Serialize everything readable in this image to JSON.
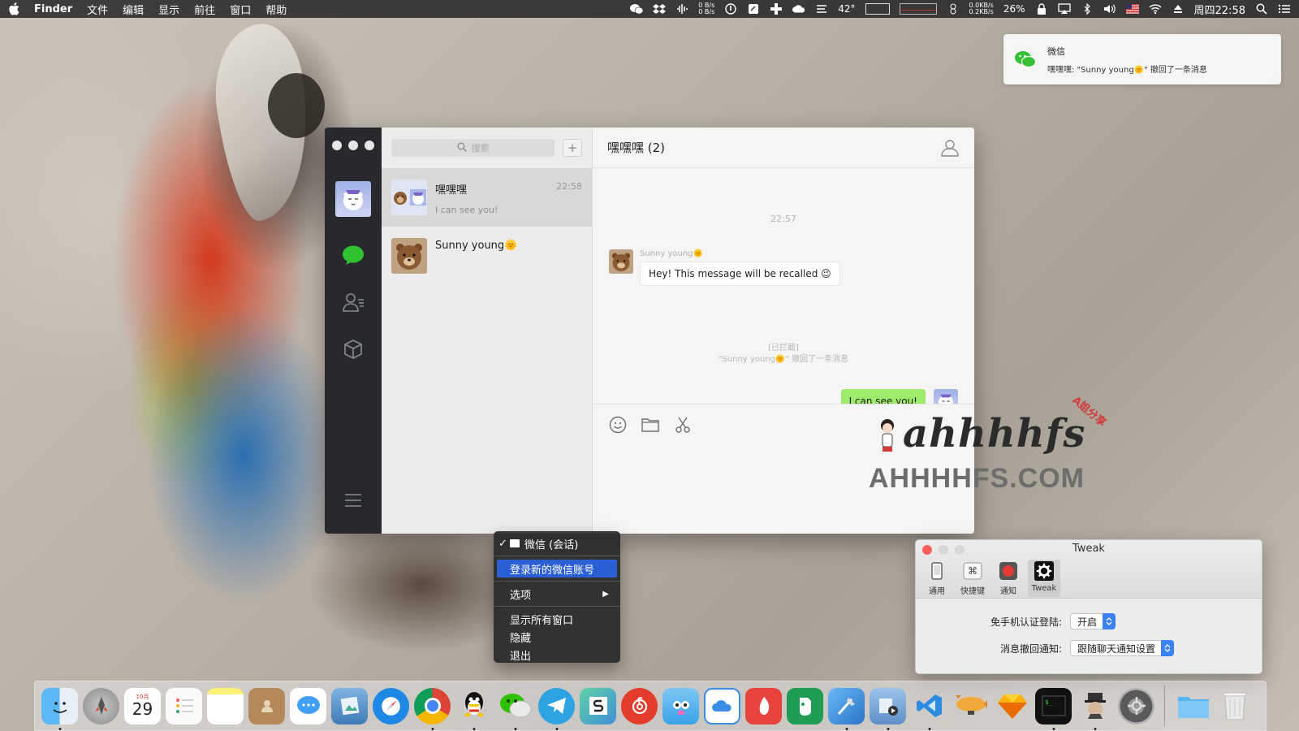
{
  "menubar": {
    "app_name": "Finder",
    "menus": [
      "文件",
      "编辑",
      "显示",
      "前往",
      "窗口",
      "帮助"
    ],
    "net_up": "0 B/s",
    "net_down": "0 B/s",
    "temperature": "42°",
    "net2_up": "0.0KB/s",
    "net2_down": "0.2KB/s",
    "battery": "26%",
    "clock": "周四22:58"
  },
  "notification": {
    "app": "微信",
    "body": "嘿嘿嘿: \"Sunny young🌞\" 撤回了一条消息"
  },
  "wechat": {
    "search_placeholder": "搜索",
    "add_label": "+",
    "conversations": [
      {
        "name": "嘿嘿嘿",
        "preview": "I can see you!",
        "time": "22:58"
      },
      {
        "name": "Sunny young🌞",
        "preview": "",
        "time": ""
      }
    ],
    "chat": {
      "title": "嘿嘿嘿 (2)",
      "timestamp": "22:57",
      "sender": "Sunny young🌞",
      "incoming_message": "Hey! This message will be recalled 😉",
      "recall_tag": "[已拦截]",
      "recall_notice": "\"Sunny young🌞\" 撤回了一条消息",
      "outgoing_message": "I can see you!"
    }
  },
  "watermark": {
    "script": "ahhhhfs",
    "tag": "A姐分享",
    "site": "AHHHHFS.COM"
  },
  "context_menu": {
    "items": [
      {
        "label": "微信 (会话)",
        "checked": true
      },
      {
        "label": "登录新的微信账号",
        "selected": true
      },
      {
        "label": "选项",
        "submenu": true
      },
      {
        "label": "显示所有窗口"
      },
      {
        "label": "隐藏"
      },
      {
        "label": "退出"
      }
    ]
  },
  "tweak": {
    "title": "Tweak",
    "tabs": [
      "通用",
      "快捷键",
      "通知",
      "Tweak"
    ],
    "active_tab": "Tweak",
    "rows": [
      {
        "label": "免手机认证登陆:",
        "value": "开启"
      },
      {
        "label": "消息撤回通知:",
        "value": "跟随聊天通知设置"
      }
    ]
  },
  "dock": {
    "calendar_day": "29",
    "calendar_month": "10月"
  },
  "colors": {
    "wechat_green": "#9eea6a",
    "sidebar": "#27292c",
    "menu_highlight": "#2a5fd6"
  }
}
